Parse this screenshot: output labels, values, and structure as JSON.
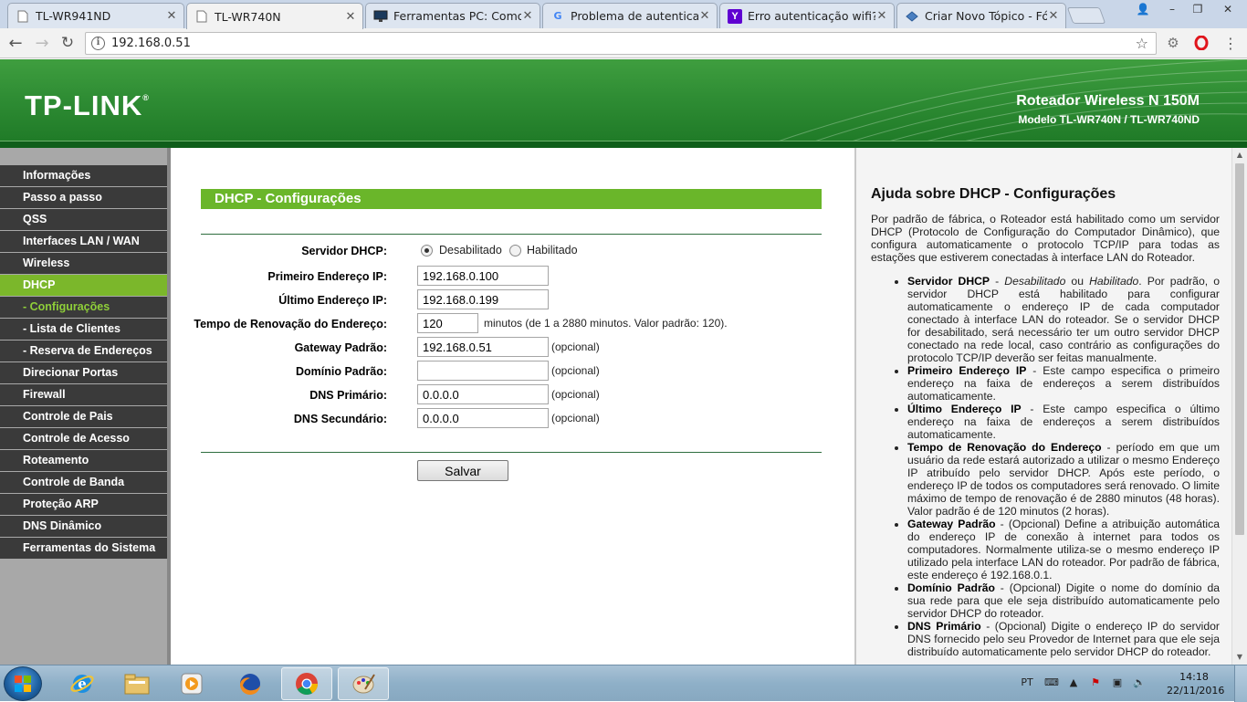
{
  "browser": {
    "tabs": [
      {
        "title": "TL-WR941ND",
        "icon": "page-icon",
        "active": false
      },
      {
        "title": "TL-WR740N",
        "icon": "page-icon",
        "active": true
      },
      {
        "title": "Ferramentas PC: Como li",
        "icon": "monitor-icon",
        "active": false
      },
      {
        "title": "Problema de autenticaçã",
        "icon": "google-icon",
        "active": false
      },
      {
        "title": "Erro autenticação wifi? | Y",
        "icon": "yahoo-icon",
        "active": false
      },
      {
        "title": "Criar Novo Tópico - Fóru",
        "icon": "forum-icon",
        "active": false
      }
    ],
    "url": "192.168.0.51"
  },
  "header": {
    "logo": "TP-LINK",
    "logo_mark": "®",
    "product_name": "Roteador Wireless N 150M",
    "product_model": "Modelo TL-WR740N / TL-WR740ND"
  },
  "menu": {
    "items": [
      {
        "label": "Informações",
        "type": "main",
        "active": false
      },
      {
        "label": "Passo a passo",
        "type": "main",
        "active": false
      },
      {
        "label": "QSS",
        "type": "main",
        "active": false
      },
      {
        "label": "Interfaces LAN / WAN",
        "type": "main",
        "active": false
      },
      {
        "label": "Wireless",
        "type": "main",
        "active": false
      },
      {
        "label": "DHCP",
        "type": "main",
        "active": true
      },
      {
        "label": "- Configurações",
        "type": "sub",
        "active": true
      },
      {
        "label": "- Lista de Clientes",
        "type": "sub",
        "active": false
      },
      {
        "label": "- Reserva de Endereços",
        "type": "sub",
        "active": false
      },
      {
        "label": "Direcionar Portas",
        "type": "main",
        "active": false
      },
      {
        "label": "Firewall",
        "type": "main",
        "active": false
      },
      {
        "label": "Controle de Pais",
        "type": "main",
        "active": false
      },
      {
        "label": "Controle de Acesso",
        "type": "main",
        "active": false
      },
      {
        "label": "Roteamento",
        "type": "main",
        "active": false
      },
      {
        "label": "Controle de Banda",
        "type": "main",
        "active": false
      },
      {
        "label": "Proteção ARP",
        "type": "main",
        "active": false
      },
      {
        "label": "DNS Dinâmico",
        "type": "main",
        "active": false
      },
      {
        "label": "Ferramentas do Sistema",
        "type": "main",
        "active": false
      }
    ]
  },
  "form": {
    "title": "DHCP - Configurações",
    "server_label": "Servidor DHCP:",
    "radio_disabled": "Desabilitado",
    "radio_enabled": "Habilitado",
    "server_value": "Desabilitado",
    "start_ip_label": "Primeiro Endereço IP:",
    "start_ip": "192.168.0.100",
    "end_ip_label": "Último Endereço IP:",
    "end_ip": "192.168.0.199",
    "lease_label": "Tempo de Renovação do Endereço:",
    "lease": "120",
    "lease_note": "minutos (de 1 a 2880 minutos. Valor padrão: 120).",
    "gateway_label": "Gateway Padrão:",
    "gateway": "192.168.0.51",
    "domain_label": "Domínio Padrão:",
    "domain": "",
    "dns1_label": "DNS Primário:",
    "dns1": "0.0.0.0",
    "dns2_label": "DNS Secundário:",
    "dns2": "0.0.0.0",
    "optional": "(opcional)",
    "save": "Salvar"
  },
  "help": {
    "title": "Ajuda sobre DHCP - Configurações",
    "intro": "Por padrão de fábrica, o Roteador está habilitado como um servidor DHCP (Protocolo de Configuração do Computador Dinâmico), que configura automaticamente o protocolo TCP/IP para todas as estações que estiverem conectadas à interface LAN do Roteador.",
    "items": [
      {
        "term": "Servidor DHCP",
        "sep": " - ",
        "em1": "Desabilitado",
        "mid": " ou ",
        "em2": "Habilitado",
        "text": ". Por padrão, o servidor DHCP está habilitado para configurar automaticamente o endereço IP de cada computador conectado à interface LAN do roteador. Se o servidor DHCP for desabilitado, será necessário ter um outro servidor DHCP conectado na rede local, caso contrário as configurações do protocolo TCP/IP deverão ser feitas manualmente."
      },
      {
        "term": "Primeiro Endereço IP",
        "text": " - Este campo especifica o primeiro endereço na faixa de endereços a serem distribuídos automaticamente."
      },
      {
        "term": "Último Endereço IP",
        "text": " - Este campo especifica o último endereço na faixa de endereços a serem distribuídos automaticamente."
      },
      {
        "term": "Tempo de Renovação do Endereço",
        "text": " - período em que um usuário da rede estará autorizado a utilizar o mesmo Endereço IP atribuído pelo servidor DHCP. Após este período, o endereço IP de todos os computadores será renovado. O limite máximo de tempo de renovação é de 2880 minutos (48 horas). Valor padrão é de 120 minutos (2 horas)."
      },
      {
        "term": "Gateway Padrão",
        "text": " - (Opcional) Define a atribuição automática do endereço IP de conexão à internet para todos os computadores. Normalmente utiliza-se o mesmo endereço IP utilizado pela interface LAN do roteador. Por padrão de fábrica, este endereço é 192.168.0.1."
      },
      {
        "term": "Domínio Padrão",
        "text": " - (Opcional) Digite o nome do domínio da sua rede para que ele seja distribuído automaticamente pelo servidor DHCP do roteador."
      },
      {
        "term": "DNS Primário",
        "text": " - (Opcional) Digite o endereço IP do servidor DNS fornecido pelo seu Provedor de Internet para que ele seja distribuído automaticamente pelo servidor DHCP do roteador."
      }
    ]
  },
  "taskbar": {
    "apps": [
      "internet-explorer-icon",
      "file-explorer-icon",
      "media-player-icon",
      "firefox-icon",
      "chrome-icon",
      "paint-icon"
    ],
    "language": "PT",
    "time": "14:18",
    "date": "22/11/2016"
  },
  "colors": {
    "green_header": "#2f8d34",
    "menu_active": "#7bb72b",
    "menu_sub_active_text": "#8fcf39",
    "title_bar": "#6ab62a"
  }
}
